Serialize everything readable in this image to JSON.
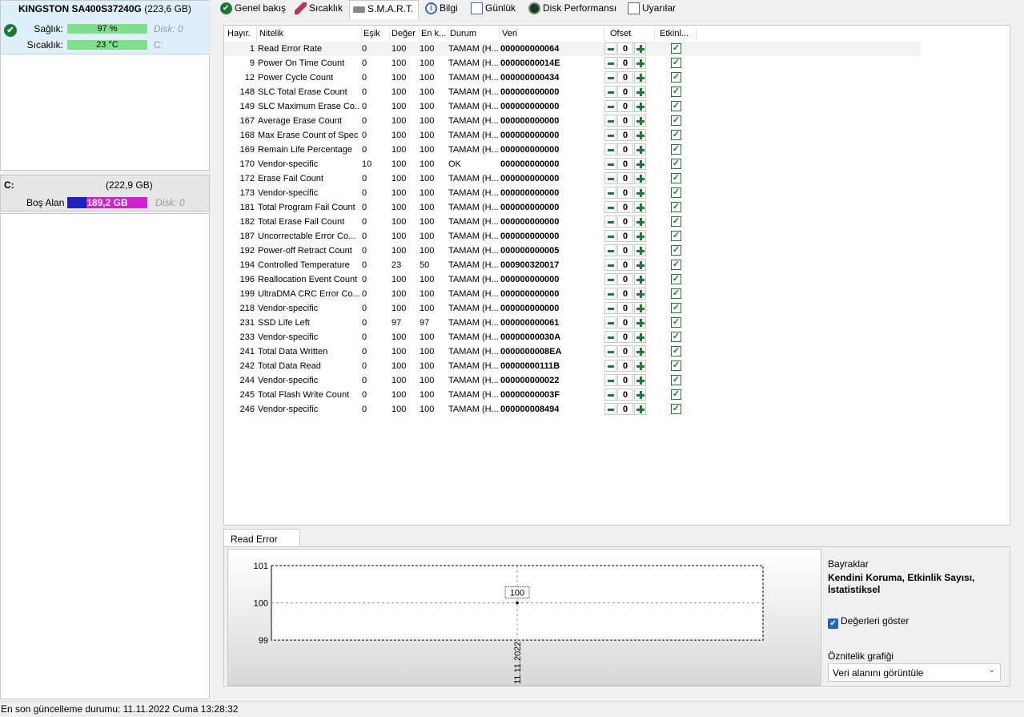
{
  "disk": {
    "model": "KINGSTON SA400S37240G",
    "capacity": "(223,6 GB)",
    "health_label": "Sağlık:",
    "health_value": "97 %",
    "health_disk": "Disk: 0",
    "temp_label": "Sıcaklık:",
    "temp_value": "23 °C",
    "temp_drive": "C:"
  },
  "volume": {
    "name": "C:",
    "size": "(222,9 GB)",
    "free_label": "Boş Alan",
    "free_value": "189,2 GB",
    "disk": "Disk: 0"
  },
  "tabs": [
    {
      "label": "Genel bakış",
      "icon": "check-circle-icon"
    },
    {
      "label": "Sıcaklık",
      "icon": "thermometer-icon"
    },
    {
      "label": "S.M.A.R.T.",
      "icon": "disk-icon"
    },
    {
      "label": "Bilgi",
      "icon": "info-icon"
    },
    {
      "label": "Günlük",
      "icon": "log-icon"
    },
    {
      "label": "Disk Performansı",
      "icon": "gauge-icon"
    },
    {
      "label": "Uyarılar",
      "icon": "warning-doc-icon"
    }
  ],
  "table": {
    "headers": [
      "Hayır.",
      "Nitelik",
      "Eşik",
      "Değer",
      "En k...",
      "Durum",
      "Veri",
      "Ofset",
      "Etkinl..."
    ],
    "rows": [
      {
        "id": "1",
        "name": "Read Error Rate",
        "th": "0",
        "val": "100",
        "worst": "100",
        "status": "TAMAM (H...",
        "raw": "000000000064",
        "offset": "0"
      },
      {
        "id": "9",
        "name": "Power On Time Count",
        "th": "0",
        "val": "100",
        "worst": "100",
        "status": "TAMAM (H...",
        "raw": "00000000014E",
        "offset": "0"
      },
      {
        "id": "12",
        "name": "Power Cycle Count",
        "th": "0",
        "val": "100",
        "worst": "100",
        "status": "TAMAM (H...",
        "raw": "000000000434",
        "offset": "0"
      },
      {
        "id": "148",
        "name": "SLC Total Erase Count",
        "th": "0",
        "val": "100",
        "worst": "100",
        "status": "TAMAM (H...",
        "raw": "000000000000",
        "offset": "0"
      },
      {
        "id": "149",
        "name": "SLC Maximum Erase Co...",
        "th": "0",
        "val": "100",
        "worst": "100",
        "status": "TAMAM (H...",
        "raw": "000000000000",
        "offset": "0"
      },
      {
        "id": "167",
        "name": "Average Erase Count",
        "th": "0",
        "val": "100",
        "worst": "100",
        "status": "TAMAM (H...",
        "raw": "000000000000",
        "offset": "0"
      },
      {
        "id": "168",
        "name": "Max Erase Count of Spec",
        "th": "0",
        "val": "100",
        "worst": "100",
        "status": "TAMAM (H...",
        "raw": "000000000000",
        "offset": "0"
      },
      {
        "id": "169",
        "name": "Remain Life Percentage",
        "th": "0",
        "val": "100",
        "worst": "100",
        "status": "TAMAM (H...",
        "raw": "000000000000",
        "offset": "0"
      },
      {
        "id": "170",
        "name": "Vendor-specific",
        "th": "10",
        "val": "100",
        "worst": "100",
        "status": "OK",
        "raw": "000000000000",
        "offset": "0"
      },
      {
        "id": "172",
        "name": "Erase Fail Count",
        "th": "0",
        "val": "100",
        "worst": "100",
        "status": "TAMAM (H...",
        "raw": "000000000000",
        "offset": "0"
      },
      {
        "id": "173",
        "name": "Vendor-specific",
        "th": "0",
        "val": "100",
        "worst": "100",
        "status": "TAMAM (H...",
        "raw": "000000000000",
        "offset": "0"
      },
      {
        "id": "181",
        "name": "Total Program Fail Count",
        "th": "0",
        "val": "100",
        "worst": "100",
        "status": "TAMAM (H...",
        "raw": "000000000000",
        "offset": "0"
      },
      {
        "id": "182",
        "name": "Total Erase Fail Count",
        "th": "0",
        "val": "100",
        "worst": "100",
        "status": "TAMAM (H...",
        "raw": "000000000000",
        "offset": "0"
      },
      {
        "id": "187",
        "name": "Uncorrectable Error Co...",
        "th": "0",
        "val": "100",
        "worst": "100",
        "status": "TAMAM (H...",
        "raw": "000000000000",
        "offset": "0"
      },
      {
        "id": "192",
        "name": "Power-off Retract Count",
        "th": "0",
        "val": "100",
        "worst": "100",
        "status": "TAMAM (H...",
        "raw": "000000000005",
        "offset": "0"
      },
      {
        "id": "194",
        "name": "Controlled Temperature",
        "th": "0",
        "val": "23",
        "worst": "50",
        "status": "TAMAM (H...",
        "raw": "000900320017",
        "offset": "0"
      },
      {
        "id": "196",
        "name": "Reallocation Event Count",
        "th": "0",
        "val": "100",
        "worst": "100",
        "status": "TAMAM (H...",
        "raw": "000000000000",
        "offset": "0"
      },
      {
        "id": "199",
        "name": "UltraDMA CRC Error Co...",
        "th": "0",
        "val": "100",
        "worst": "100",
        "status": "TAMAM (H...",
        "raw": "000000000000",
        "offset": "0"
      },
      {
        "id": "218",
        "name": "Vendor-specific",
        "th": "0",
        "val": "100",
        "worst": "100",
        "status": "TAMAM (H...",
        "raw": "000000000000",
        "offset": "0"
      },
      {
        "id": "231",
        "name": "SSD Life Left",
        "th": "0",
        "val": "97",
        "worst": "97",
        "status": "TAMAM (H...",
        "raw": "000000000061",
        "offset": "0"
      },
      {
        "id": "233",
        "name": "Vendor-specific",
        "th": "0",
        "val": "100",
        "worst": "100",
        "status": "TAMAM (H...",
        "raw": "00000000030A",
        "offset": "0"
      },
      {
        "id": "241",
        "name": "Total Data Written",
        "th": "0",
        "val": "100",
        "worst": "100",
        "status": "TAMAM (H...",
        "raw": "0000000008EA",
        "offset": "0"
      },
      {
        "id": "242",
        "name": "Total Data Read",
        "th": "0",
        "val": "100",
        "worst": "100",
        "status": "TAMAM (H...",
        "raw": "00000000111B",
        "offset": "0"
      },
      {
        "id": "244",
        "name": "Vendor-specific",
        "th": "0",
        "val": "100",
        "worst": "100",
        "status": "TAMAM (H...",
        "raw": "000000000022",
        "offset": "0"
      },
      {
        "id": "245",
        "name": "Total Flash Write Count",
        "th": "0",
        "val": "100",
        "worst": "100",
        "status": "TAMAM (H...",
        "raw": "00000000003F",
        "offset": "0"
      },
      {
        "id": "246",
        "name": "Vendor-specific",
        "th": "0",
        "val": "100",
        "worst": "100",
        "status": "TAMAM (H...",
        "raw": "000000008494",
        "offset": "0"
      }
    ]
  },
  "detail": {
    "tab_label": "Read Error Rate",
    "flags_title": "Bayraklar",
    "flags_value": "Kendini Koruma, Etkinlik Sayısı, İstatistiksel",
    "show_values_label": "Değerleri göster",
    "show_values_checked": true,
    "attr_graph_label": "Öznitelik grafiği",
    "attr_graph_selected": "Veri alanını görüntüle"
  },
  "chart_data": {
    "type": "line",
    "x": [
      "11.11.2022"
    ],
    "series": [
      {
        "values": [
          100
        ]
      }
    ],
    "ylim": [
      99,
      101
    ],
    "yticks": [
      "101",
      "100",
      "99"
    ],
    "data_labels": [
      "100"
    ],
    "grid": true
  },
  "status_bar": {
    "text": "En son güncelleme durumu: 11.11.2022 Cuma 13:28:32"
  },
  "colors": {
    "health_bar": "#7ee08a",
    "accent_green": "#1a7a2e",
    "free_space_used": "#2020c0",
    "free_space_free": "#d020d0",
    "header_bg": "#dff0fb"
  }
}
